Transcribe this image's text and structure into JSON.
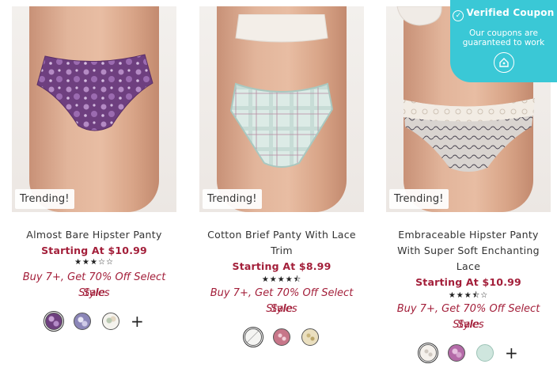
{
  "products": [
    {
      "badge": "Trending!",
      "name_lines": [
        "Almost Bare Hipster Panty"
      ],
      "price": "Starting At $10.99",
      "rating_stars": "★★★☆☆",
      "promo_lines": [
        "Buy 7+, Get 70% Off Select Sale",
        "Styles"
      ],
      "swatches": [
        "purple-floral",
        "blue-floral",
        "white-floral"
      ],
      "more": "+"
    },
    {
      "badge": "Trending!",
      "name_lines": [
        "Cotton Brief Panty With Lace",
        "Trim"
      ],
      "price": "Starting At $8.99",
      "rating_stars": "★★★★⯪",
      "promo_lines": [
        "Buy 7+, Get 70% Off Select Sale",
        "Styles"
      ],
      "swatches": [
        "mint-plaid",
        "pink-print",
        "beige-print"
      ],
      "more": ""
    },
    {
      "badge": "Trending!",
      "name_lines": [
        "Embraceable Hipster Panty",
        "With Super Soft Enchanting",
        "Lace"
      ],
      "price": "Starting At $10.99",
      "rating_stars": "★★★⯪☆",
      "promo_lines": [
        "Buy 7+, Get 70% Off Select Sale",
        "Styles"
      ],
      "swatches": [
        "ivory-print",
        "pink-floral",
        "mint"
      ],
      "more": "+"
    }
  ],
  "coupon": {
    "title": "Verified Coupon",
    "subtitle_line1": "Our coupons are",
    "subtitle_line2": "guaranteed to work",
    "check_icon": "check-circle-icon",
    "button_icon": "tag-icon"
  },
  "colors": {
    "price": "#a31f3a",
    "coupon": "#3ac8d6"
  }
}
